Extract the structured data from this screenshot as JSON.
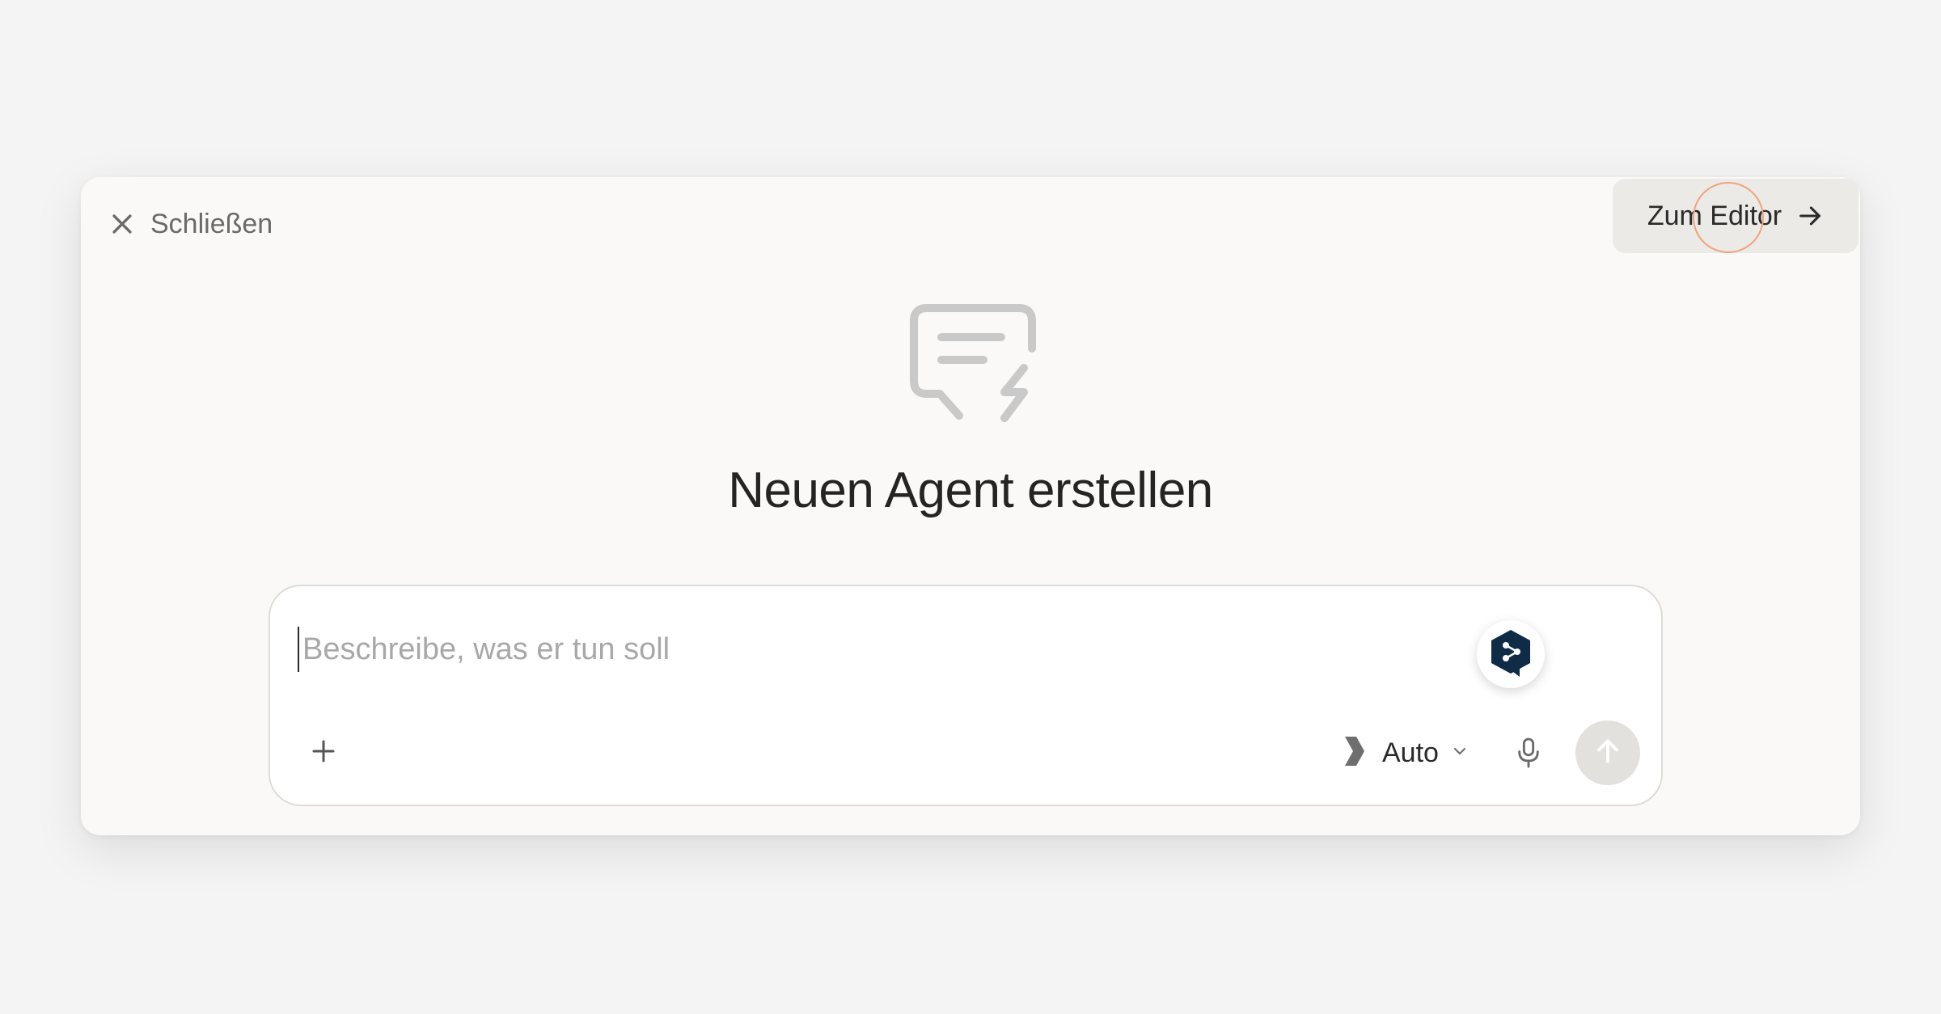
{
  "header": {
    "close_label": "Schließen",
    "editor_label": "Zum Editor"
  },
  "hero": {
    "icon": "message-lightning-icon",
    "title": "Neuen Agent erstellen"
  },
  "composer": {
    "placeholder": "Beschreibe, was er tun soll",
    "value": "",
    "model_label": "Auto",
    "translator_badge_icon": "deepl-logo-icon"
  },
  "colors": {
    "modal_bg": "#faf9f7",
    "page_bg": "#f4f4f4",
    "editor_button_bg": "#ebeae6",
    "send_button_bg": "#e2e1dd",
    "deepl_navy": "#0f2b46",
    "cursor_ring": "#f0a37a"
  }
}
